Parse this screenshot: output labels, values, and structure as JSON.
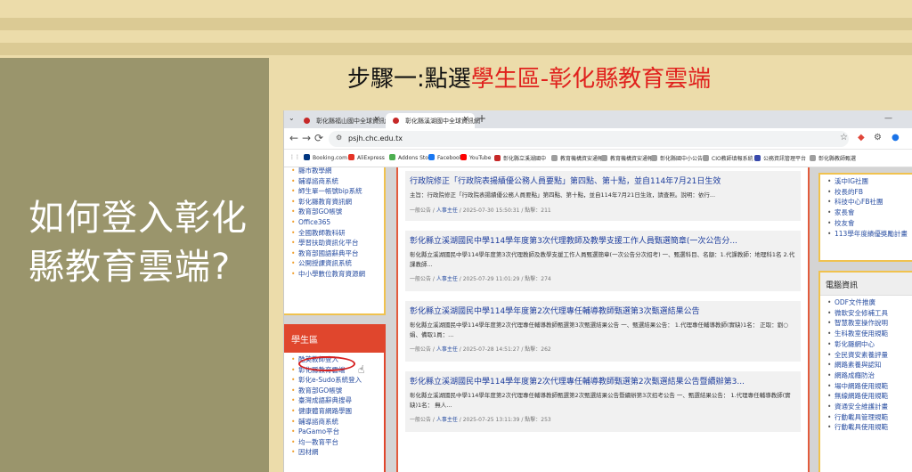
{
  "slide": {
    "title": "如何登入彰化縣教育雲端?",
    "step_prefix": "步驟一:點選",
    "step_highlight": "學生區-彰化縣教育雲端"
  },
  "browser": {
    "tabs": [
      {
        "label": "彰化縣福山國中全球資訊網",
        "active": false
      },
      {
        "label": "彰化縣溪湖國中全球資訊網",
        "active": true
      }
    ],
    "url": "psjh.chc.edu.tx",
    "bookmarks": [
      "Booking.com",
      "AliExpress",
      "Addons Store",
      "Facebook",
      "YouTube",
      "彰化縣立溪湖國中",
      "教育機構資安通報",
      "教育機構資安通報",
      "彰化縣國中小公告",
      "CIO教師填報系統",
      "公務資訊管理平台",
      "彰化縣教師甄選"
    ]
  },
  "left_sidebar": {
    "top_links": [
      "縣市教學網",
      "輔導諮商系統",
      "師生單一帳號bip系統",
      "彰化縣教育資訊網",
      "教育部GO帳號",
      "Office365",
      "全國教師教科研",
      "學習扶助資訊化平台",
      "教育部國語辭典平台",
      "公開授課資訊系統",
      "中小學數位教育資源網"
    ],
    "student_title": "學生區",
    "student_links": [
      "酷英教師登入",
      "彰化縣教育雲端",
      "彰化e-Sudo系統登入",
      "教育部GO帳號",
      "臺灣成語辭典搜尋",
      "健康體育網路學園",
      "輔導諮商系統",
      "PaGamo平台",
      "均一教育平台",
      "因材網"
    ]
  },
  "news": [
    {
      "title": "行政院修正「行政院表揚績優公務人員要點」第四點、第十點，並自114年7月21日生效",
      "desc": "主旨：行政院修正「行政院表揚績優公務人員要點」第四點、第十點，並自114年7月21日生效，請查照。說明：依行...",
      "category": "一般公告",
      "author": "人事主任",
      "date": "2025-07-30 15:50:31",
      "hits": "點擊：211"
    },
    {
      "title": "彰化縣立溪湖國民中學114學年度第3次代理教師及教學支援工作人員甄選簡章(一次公告分...",
      "desc": "彰化縣立溪湖國民中學114學年度第3次代理教師及教學支援工作人員甄選簡章(一次公告分次招考) 一、甄選科目、名額：1.代課教師：地理科1名 2.代課教師...",
      "category": "一般公告",
      "author": "人事主任",
      "date": "2025-07-29 11:01:29",
      "hits": "點擊：274"
    },
    {
      "title": "彰化縣立溪湖國民中學114學年度第2次代理專任輔導教師甄選第3次甄選結果公告",
      "desc": "彰化縣立溪湖國民中學114學年度第2次代理專任輔導教師甄選第3次甄選結果公告 一、甄選結果公告： 1.代理專任輔導教師(實缺)1名： 正取：劉○娟、備取1員：...",
      "category": "一般公告",
      "author": "人事主任",
      "date": "2025-07-28 14:51:27",
      "hits": "點擊：262"
    },
    {
      "title": "彰化縣立溪湖國民中學114學年度第2次代理專任輔導教師甄選第2次甄選結果公告暨續辦第3...",
      "desc": "彰化縣立溪湖國民中學114學年度第2次代理專任輔導教師甄選第2次甄選結果公告暨續辦第3次招考公告 一、甄選結果公告： 1.代理專任輔導教師(實缺)1名： 無人...",
      "category": "一般公告",
      "author": "人事主任",
      "date": "2025-07-25 13:11:39",
      "hits": "點擊：253"
    }
  ],
  "right_sidebar": {
    "top_links": [
      "溪中IG社團",
      "校長的FB",
      "科技中心FB社團",
      "家長會",
      "校友會",
      "113學年度績優獎勵計畫"
    ],
    "title": "電腦資訊",
    "links": [
      "ODF文件推廣",
      "微軟安全修補工具",
      "智慧教室操作說明",
      "生科教室使用規範",
      "彰化縣網中心",
      "全民資安素養評量",
      "網路素養與認知",
      "網路成癮防治",
      "場中網路使用規範",
      "無線網路使用規範",
      "資通安全維護計畫",
      "行動載具管理規範",
      "行動載具使用規範"
    ]
  },
  "colors": {
    "accent": "#e0211d",
    "slide_panel": "#9a956c",
    "slide_bg": "#ecdcaa",
    "student_header": "#e0462d",
    "link": "#2a4fa2"
  }
}
